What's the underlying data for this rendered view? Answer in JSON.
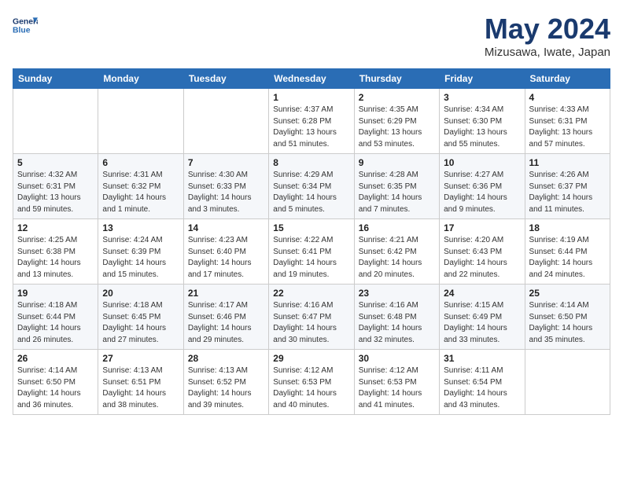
{
  "header": {
    "logo_line1": "General",
    "logo_line2": "Blue",
    "month": "May 2024",
    "location": "Mizusawa, Iwate, Japan"
  },
  "weekdays": [
    "Sunday",
    "Monday",
    "Tuesday",
    "Wednesday",
    "Thursday",
    "Friday",
    "Saturday"
  ],
  "weeks": [
    [
      {
        "day": "",
        "info": ""
      },
      {
        "day": "",
        "info": ""
      },
      {
        "day": "",
        "info": ""
      },
      {
        "day": "1",
        "info": "Sunrise: 4:37 AM\nSunset: 6:28 PM\nDaylight: 13 hours\nand 51 minutes."
      },
      {
        "day": "2",
        "info": "Sunrise: 4:35 AM\nSunset: 6:29 PM\nDaylight: 13 hours\nand 53 minutes."
      },
      {
        "day": "3",
        "info": "Sunrise: 4:34 AM\nSunset: 6:30 PM\nDaylight: 13 hours\nand 55 minutes."
      },
      {
        "day": "4",
        "info": "Sunrise: 4:33 AM\nSunset: 6:31 PM\nDaylight: 13 hours\nand 57 minutes."
      }
    ],
    [
      {
        "day": "5",
        "info": "Sunrise: 4:32 AM\nSunset: 6:31 PM\nDaylight: 13 hours\nand 59 minutes."
      },
      {
        "day": "6",
        "info": "Sunrise: 4:31 AM\nSunset: 6:32 PM\nDaylight: 14 hours\nand 1 minute."
      },
      {
        "day": "7",
        "info": "Sunrise: 4:30 AM\nSunset: 6:33 PM\nDaylight: 14 hours\nand 3 minutes."
      },
      {
        "day": "8",
        "info": "Sunrise: 4:29 AM\nSunset: 6:34 PM\nDaylight: 14 hours\nand 5 minutes."
      },
      {
        "day": "9",
        "info": "Sunrise: 4:28 AM\nSunset: 6:35 PM\nDaylight: 14 hours\nand 7 minutes."
      },
      {
        "day": "10",
        "info": "Sunrise: 4:27 AM\nSunset: 6:36 PM\nDaylight: 14 hours\nand 9 minutes."
      },
      {
        "day": "11",
        "info": "Sunrise: 4:26 AM\nSunset: 6:37 PM\nDaylight: 14 hours\nand 11 minutes."
      }
    ],
    [
      {
        "day": "12",
        "info": "Sunrise: 4:25 AM\nSunset: 6:38 PM\nDaylight: 14 hours\nand 13 minutes."
      },
      {
        "day": "13",
        "info": "Sunrise: 4:24 AM\nSunset: 6:39 PM\nDaylight: 14 hours\nand 15 minutes."
      },
      {
        "day": "14",
        "info": "Sunrise: 4:23 AM\nSunset: 6:40 PM\nDaylight: 14 hours\nand 17 minutes."
      },
      {
        "day": "15",
        "info": "Sunrise: 4:22 AM\nSunset: 6:41 PM\nDaylight: 14 hours\nand 19 minutes."
      },
      {
        "day": "16",
        "info": "Sunrise: 4:21 AM\nSunset: 6:42 PM\nDaylight: 14 hours\nand 20 minutes."
      },
      {
        "day": "17",
        "info": "Sunrise: 4:20 AM\nSunset: 6:43 PM\nDaylight: 14 hours\nand 22 minutes."
      },
      {
        "day": "18",
        "info": "Sunrise: 4:19 AM\nSunset: 6:44 PM\nDaylight: 14 hours\nand 24 minutes."
      }
    ],
    [
      {
        "day": "19",
        "info": "Sunrise: 4:18 AM\nSunset: 6:44 PM\nDaylight: 14 hours\nand 26 minutes."
      },
      {
        "day": "20",
        "info": "Sunrise: 4:18 AM\nSunset: 6:45 PM\nDaylight: 14 hours\nand 27 minutes."
      },
      {
        "day": "21",
        "info": "Sunrise: 4:17 AM\nSunset: 6:46 PM\nDaylight: 14 hours\nand 29 minutes."
      },
      {
        "day": "22",
        "info": "Sunrise: 4:16 AM\nSunset: 6:47 PM\nDaylight: 14 hours\nand 30 minutes."
      },
      {
        "day": "23",
        "info": "Sunrise: 4:16 AM\nSunset: 6:48 PM\nDaylight: 14 hours\nand 32 minutes."
      },
      {
        "day": "24",
        "info": "Sunrise: 4:15 AM\nSunset: 6:49 PM\nDaylight: 14 hours\nand 33 minutes."
      },
      {
        "day": "25",
        "info": "Sunrise: 4:14 AM\nSunset: 6:50 PM\nDaylight: 14 hours\nand 35 minutes."
      }
    ],
    [
      {
        "day": "26",
        "info": "Sunrise: 4:14 AM\nSunset: 6:50 PM\nDaylight: 14 hours\nand 36 minutes."
      },
      {
        "day": "27",
        "info": "Sunrise: 4:13 AM\nSunset: 6:51 PM\nDaylight: 14 hours\nand 38 minutes."
      },
      {
        "day": "28",
        "info": "Sunrise: 4:13 AM\nSunset: 6:52 PM\nDaylight: 14 hours\nand 39 minutes."
      },
      {
        "day": "29",
        "info": "Sunrise: 4:12 AM\nSunset: 6:53 PM\nDaylight: 14 hours\nand 40 minutes."
      },
      {
        "day": "30",
        "info": "Sunrise: 4:12 AM\nSunset: 6:53 PM\nDaylight: 14 hours\nand 41 minutes."
      },
      {
        "day": "31",
        "info": "Sunrise: 4:11 AM\nSunset: 6:54 PM\nDaylight: 14 hours\nand 43 minutes."
      },
      {
        "day": "",
        "info": ""
      }
    ]
  ]
}
